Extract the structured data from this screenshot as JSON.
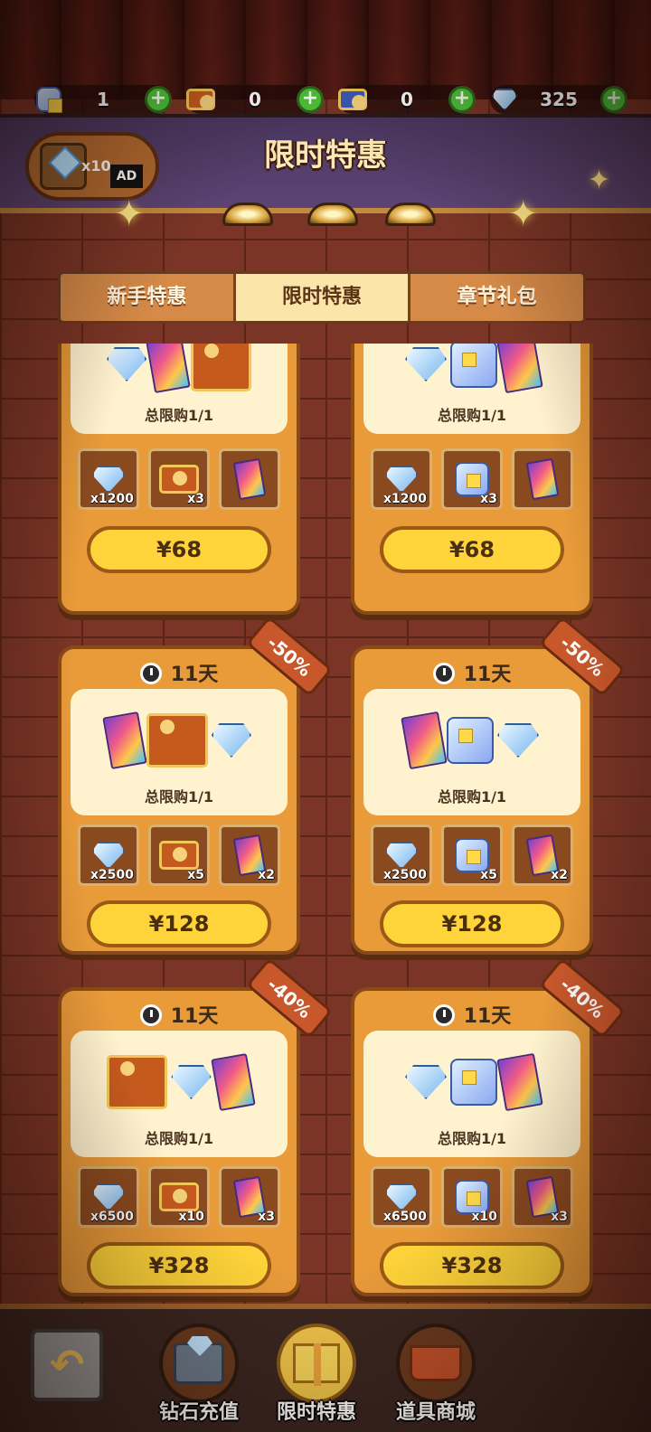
{
  "currencies": [
    {
      "icon": "cube-icon",
      "value": "1"
    },
    {
      "icon": "ticket-icon",
      "value": "0"
    },
    {
      "icon": "blue-ticket-icon",
      "value": "0"
    },
    {
      "icon": "diamond-icon",
      "value": "325"
    }
  ],
  "plus_label": "+",
  "header": {
    "title": "限时特惠",
    "chest_ad": {
      "count": "x10",
      "ad_label": "AD"
    }
  },
  "tabs": [
    {
      "label": "新手特惠",
      "active": false
    },
    {
      "label": "限时特惠",
      "active": true
    },
    {
      "label": "章节礼包",
      "active": false
    }
  ],
  "cards": [
    {
      "timer": "",
      "discount": "",
      "limit": "总限购1/1",
      "price": "¥68",
      "items": [
        {
          "icon": "diamond-icon",
          "count": "x1200"
        },
        {
          "icon": "ticket-icon",
          "count": "x3"
        },
        {
          "icon": "card-pack-icon",
          "count": ""
        }
      ]
    },
    {
      "timer": "",
      "discount": "",
      "limit": "总限购1/1",
      "price": "¥68",
      "items": [
        {
          "icon": "diamond-icon",
          "count": "x1200"
        },
        {
          "icon": "cube-icon",
          "count": "x3"
        },
        {
          "icon": "card-pack-icon",
          "count": ""
        }
      ]
    },
    {
      "timer": "11天",
      "discount": "-50%",
      "limit": "总限购1/1",
      "price": "¥128",
      "items": [
        {
          "icon": "diamond-icon",
          "count": "x2500"
        },
        {
          "icon": "ticket-icon",
          "count": "x5"
        },
        {
          "icon": "card-pack-icon",
          "count": "x2"
        }
      ]
    },
    {
      "timer": "11天",
      "discount": "-50%",
      "limit": "总限购1/1",
      "price": "¥128",
      "items": [
        {
          "icon": "diamond-icon",
          "count": "x2500"
        },
        {
          "icon": "cube-icon",
          "count": "x5"
        },
        {
          "icon": "card-pack-icon",
          "count": "x2"
        }
      ]
    },
    {
      "timer": "11天",
      "discount": "-40%",
      "limit": "总限购1/1",
      "price": "¥328",
      "items": [
        {
          "icon": "diamond-icon",
          "count": "x6500"
        },
        {
          "icon": "ticket-icon",
          "count": "x10"
        },
        {
          "icon": "card-pack-icon",
          "count": "x3"
        }
      ]
    },
    {
      "timer": "11天",
      "discount": "-40%",
      "limit": "总限购1/1",
      "price": "¥328",
      "items": [
        {
          "icon": "diamond-icon",
          "count": "x6500"
        },
        {
          "icon": "cube-icon",
          "count": "x10"
        },
        {
          "icon": "card-pack-icon",
          "count": "x3"
        }
      ]
    }
  ],
  "nav": {
    "back_icon": "back-arrow-icon",
    "back_glyph": "↶",
    "items": [
      {
        "label": "钻石充值",
        "icon": "diamond-crate-icon",
        "active": false
      },
      {
        "label": "限时特惠",
        "icon": "gift-box-icon",
        "active": true
      },
      {
        "label": "道具商城",
        "icon": "shop-basket-icon",
        "active": false
      }
    ]
  },
  "colors": {
    "accent": "#ffd43a",
    "card": "#e99b3a",
    "banner": "#5d4474",
    "plus": "#4fc43a"
  }
}
